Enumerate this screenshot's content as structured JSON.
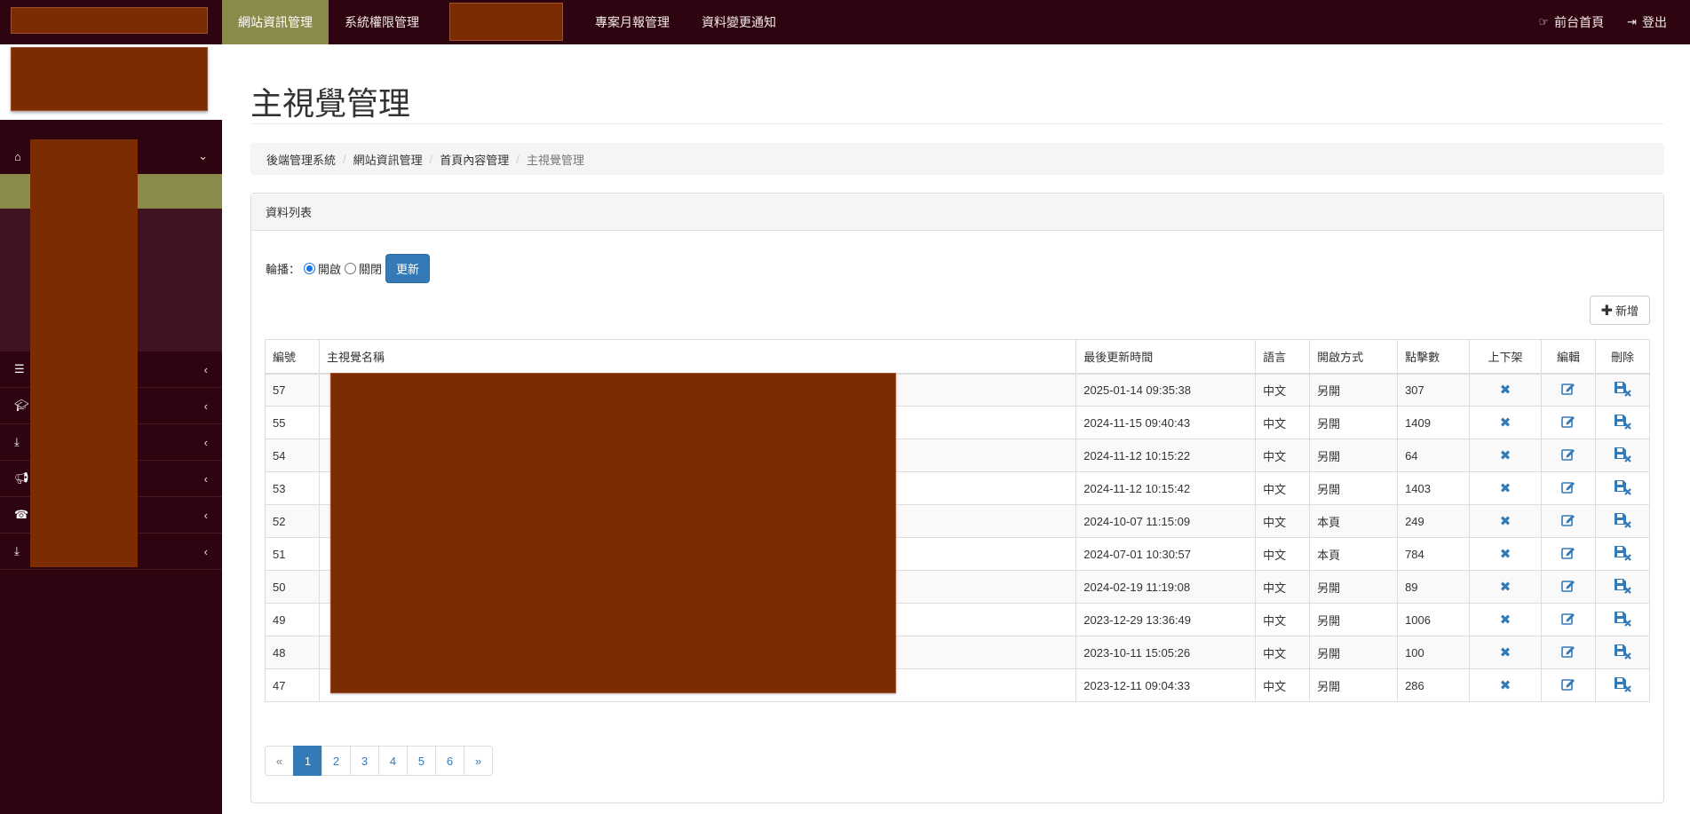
{
  "topnav": {
    "items": [
      {
        "label": "網站資訊管理",
        "active": true
      },
      {
        "label": "系統權限管理",
        "active": false
      },
      {
        "label": "專案月報管理",
        "active": false
      },
      {
        "label": "資料變更通知",
        "active": false
      }
    ],
    "right": [
      {
        "label": "前台首頁",
        "icon": "hand-point-icon"
      },
      {
        "label": "登出",
        "icon": "sign-out-icon"
      }
    ]
  },
  "sidebar": {
    "items": [
      {
        "icon": "home-icon",
        "chevron": "chevron-down-icon"
      },
      {
        "icon": "list-icon",
        "chevron": "chevron-left-icon"
      },
      {
        "icon": "graduation-cap-icon",
        "chevron": "chevron-left-icon"
      },
      {
        "icon": "download-icon",
        "chevron": "chevron-left-icon"
      },
      {
        "icon": "bullhorn-icon",
        "chevron": "chevron-left-icon"
      },
      {
        "icon": "phone-icon",
        "chevron": "chevron-left-icon"
      },
      {
        "icon": "download-icon",
        "chevron": "chevron-left-icon"
      }
    ]
  },
  "page": {
    "title": "主視覺管理",
    "breadcrumb": [
      "後端管理系統",
      "網站資訊管理",
      "首頁內容管理",
      "主視覺管理"
    ]
  },
  "panel": {
    "heading": "資料列表",
    "carousel_label": "輪播：",
    "option_on": "開啟",
    "option_off": "關閉",
    "carousel_value": "開啟",
    "update_button": "更新",
    "add_button": "新增"
  },
  "table": {
    "headers": [
      "編號",
      "主視覺名稱",
      "最後更新時間",
      "語言",
      "開啟方式",
      "點擊數",
      "上下架",
      "編輯",
      "刪除"
    ],
    "rows": [
      {
        "id": "57",
        "name": "",
        "updated": "2025-01-14 09:35:38",
        "lang": "中文",
        "open": "另開",
        "clicks": "307"
      },
      {
        "id": "55",
        "name": "",
        "updated": "2024-11-15 09:40:43",
        "lang": "中文",
        "open": "另開",
        "clicks": "1409"
      },
      {
        "id": "54",
        "name": "",
        "updated": "2024-11-12 10:15:22",
        "lang": "中文",
        "open": "另開",
        "clicks": "64"
      },
      {
        "id": "53",
        "name": "",
        "updated": "2024-11-12 10:15:42",
        "lang": "中文",
        "open": "另開",
        "clicks": "1403"
      },
      {
        "id": "52",
        "name": "",
        "updated": "2024-10-07 11:15:09",
        "lang": "中文",
        "open": "本頁",
        "clicks": "249"
      },
      {
        "id": "51",
        "name": "",
        "updated": "2024-07-01 10:30:57",
        "lang": "中文",
        "open": "本頁",
        "clicks": "784"
      },
      {
        "id": "50",
        "name": "",
        "updated": "2024-02-19 11:19:08",
        "lang": "中文",
        "open": "另開",
        "clicks": "89"
      },
      {
        "id": "49",
        "name": "",
        "updated": "2023-12-29 13:36:49",
        "lang": "中文",
        "open": "另開",
        "clicks": "1006"
      },
      {
        "id": "48",
        "name": "",
        "updated": "2023-10-11 15:05:26",
        "lang": "中文",
        "open": "另開",
        "clicks": "100"
      },
      {
        "id": "47",
        "name": "",
        "updated": "2023-12-11 09:04:33",
        "lang": "中文",
        "open": "另開",
        "clicks": "286"
      }
    ]
  },
  "pagination": {
    "prev": "«",
    "pages": [
      "1",
      "2",
      "3",
      "4",
      "5",
      "6"
    ],
    "current": "1",
    "next": "»"
  },
  "colors": {
    "nav_bg": "#2d0410",
    "active_bg": "#8a8a4a",
    "redacted": "#7b2c00",
    "primary": "#337ab7"
  }
}
